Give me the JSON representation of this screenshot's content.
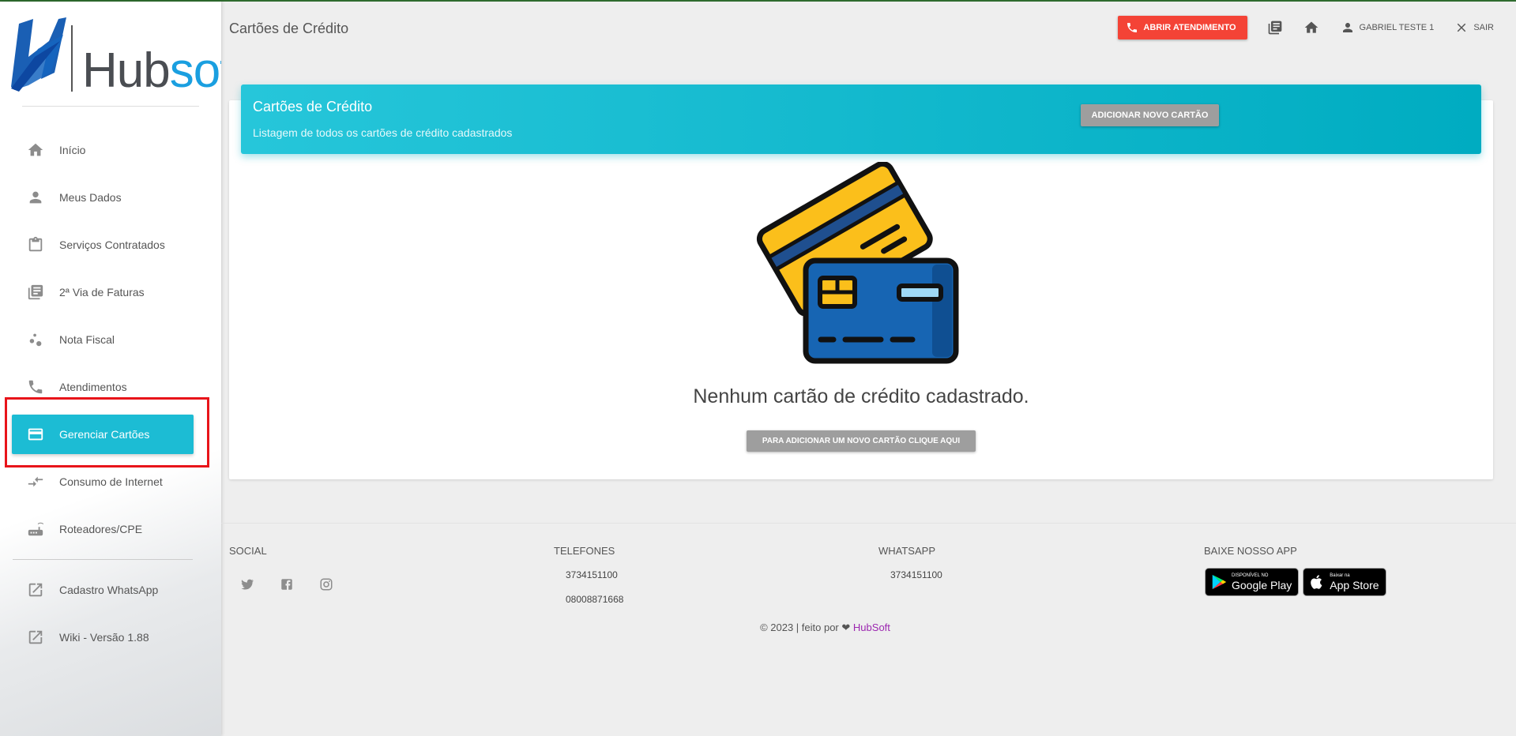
{
  "brand": {
    "logo_part1": "Hub",
    "logo_part2": "soft"
  },
  "sidebar": {
    "items": [
      {
        "label": "Início",
        "icon": "home-icon"
      },
      {
        "label": "Meus Dados",
        "icon": "person-icon"
      },
      {
        "label": "Serviços Contratados",
        "icon": "clipboard-icon"
      },
      {
        "label": "2ª Via de Faturas",
        "icon": "library-books-icon"
      },
      {
        "label": "Nota Fiscal",
        "icon": "bubbles-icon"
      },
      {
        "label": "Atendimentos",
        "icon": "phone-icon"
      },
      {
        "label": "Gerenciar Cartões",
        "icon": "credit-card-icon",
        "active": true
      },
      {
        "label": "Consumo de Internet",
        "icon": "compare-arrows-icon"
      },
      {
        "label": "Roteadores/CPE",
        "icon": "router-icon"
      }
    ],
    "external": [
      {
        "label": "Cadastro WhatsApp",
        "icon": "open-in-new-icon"
      },
      {
        "label": "Wiki - Versão 1.88",
        "icon": "open-in-new-icon"
      }
    ]
  },
  "header": {
    "title": "Cartões de Crédito",
    "support_button": "ABRIR ATENDIMENTO",
    "user_name": "GABRIEL TESTE 1",
    "logout": "SAIR"
  },
  "card": {
    "title": "Cartões de Crédito",
    "subtitle": "Listagem de todos os cartões de crédito cadastrados",
    "add_button": "ADICIONAR NOVO CARTÃO",
    "empty_message": "Nenhum cartão de crédito cadastrado.",
    "empty_button": "PARA ADICIONAR UM NOVO CARTÃO CLIQUE AQUI"
  },
  "footer": {
    "social_heading": "SOCIAL",
    "phones_heading": "TELEFONES",
    "phones": [
      "3734151100",
      "08008871668"
    ],
    "whatsapp_heading": "WHATSAPP",
    "whatsapp": "3734151100",
    "app_heading": "BAIXE NOSSO APP",
    "google_play_small": "DISPONÍVEL NO",
    "google_play_big": "Google Play",
    "app_store_small": "Baixar na",
    "app_store_big": "App Store",
    "copyright": "© 2023 | feito por",
    "copyright_brand": "HubSoft"
  },
  "colors": {
    "accent": "#1cbcd4",
    "danger": "#f44336",
    "highlight": "#e8141a",
    "brand_blue": "#1a9fe0"
  }
}
